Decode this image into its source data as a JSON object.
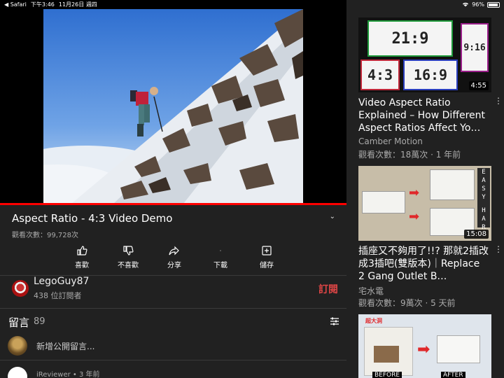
{
  "status_bar": {
    "back_app": "◀ Safari",
    "time": "下午3:46",
    "date": "11月26日 週四",
    "battery": "96%"
  },
  "player": {
    "progress_fraction": 1.0
  },
  "video": {
    "title": "Aspect Ratio - 4:3 Video Demo",
    "views": "觀看次數：99,728次"
  },
  "actions": [
    {
      "label": "喜歡",
      "icon": "thumbs-up-icon"
    },
    {
      "label": "不喜歡",
      "icon": "thumbs-down-icon"
    },
    {
      "label": "分享",
      "icon": "share-icon"
    },
    {
      "label": "下載",
      "icon": "download-icon"
    },
    {
      "label": "儲存",
      "icon": "save-icon"
    }
  ],
  "channel": {
    "name": "LegoGuy87",
    "subscribers": "438 位訂閱者",
    "subscribe_label": "訂閱"
  },
  "comments": {
    "heading": "留言",
    "count": "89",
    "add_placeholder": "新增公開留言...",
    "first_comment_meta": "iReviewer • 3 年前"
  },
  "recommendations": [
    {
      "title": "Video Aspect Ratio Explained – How Different Aspect Ratios Affect Yo…",
      "channel": "Camber Motion",
      "stats": "觀看次數：18萬次 · 1 年前",
      "duration": "4:55",
      "thumb_labels": [
        "21:9",
        "9:16",
        "4:3",
        "16:9"
      ]
    },
    {
      "title": "插座又不夠用了!!? 那就2插改成3插吧(雙版本)｜Replace 2 Gang Outlet B…",
      "channel": "宅水電",
      "stats": "觀看次數：9萬次 · 5 天前",
      "duration": "15:08",
      "thumb_labels": [
        "E",
        "A",
        "S",
        "Y",
        "H",
        "A",
        "R"
      ]
    },
    {
      "title": "",
      "channel": "",
      "stats": "",
      "duration": "",
      "thumb_labels": [
        "超大洞",
        "BEFORE",
        "AFTER"
      ]
    }
  ]
}
